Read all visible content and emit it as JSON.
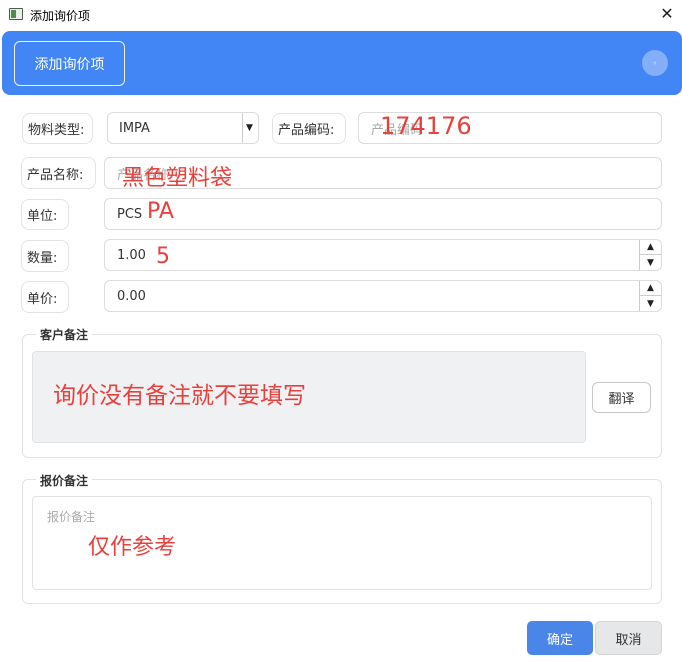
{
  "window": {
    "title": "添加询价项",
    "close_glyph": "✕"
  },
  "header": {
    "add_button": "添加询价项",
    "indicator_glyph": "◦"
  },
  "form": {
    "material_type": {
      "label": "物料类型:",
      "value": "IMPA"
    },
    "product_code": {
      "label": "产品编码:",
      "placeholder": "产品编码",
      "annotation": "174176"
    },
    "product_name": {
      "label": "产品名称:",
      "placeholder": "产品名称",
      "annotation": "黑色塑料袋"
    },
    "unit": {
      "label": "单位:",
      "value": "PCS",
      "annotation": "PA"
    },
    "quantity": {
      "label": "数量:",
      "value": "1.00",
      "annotation": "5"
    },
    "unit_price": {
      "label": "单价:",
      "value": "0.00"
    }
  },
  "customer_note": {
    "title": "客户备注",
    "annotation": "询价没有备注就不要填写",
    "translate_button": "翻译"
  },
  "quote_note": {
    "title": "报价备注",
    "placeholder": "报价备注",
    "annotation": "仅作参考"
  },
  "footer": {
    "ok_button": "确定",
    "cancel_button": "取消"
  },
  "icons": {
    "select_arrow": "▼",
    "stepper_up": "▲",
    "stepper_down": "▼"
  },
  "colors": {
    "accent": "#4285f4",
    "annotation_red": "#e8413c",
    "ok_button": "#4a86e8"
  }
}
